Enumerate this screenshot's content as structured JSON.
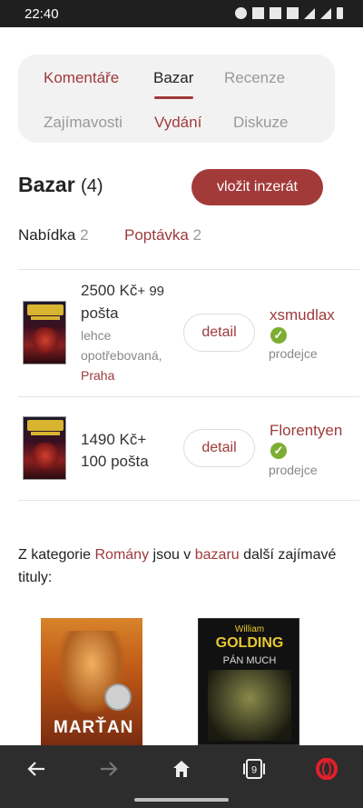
{
  "status_bar": {
    "time": "22:40"
  },
  "tabs": [
    {
      "label": "Komentáře",
      "state": "link"
    },
    {
      "label": "Bazar",
      "state": "active"
    },
    {
      "label": "Recenze",
      "state": "inactive"
    },
    {
      "label": "Zajímavosti",
      "state": "inactive"
    },
    {
      "label": "Vydání",
      "state": "link"
    },
    {
      "label": "Diskuze",
      "state": "inactive"
    }
  ],
  "bazar": {
    "title": "Bazar",
    "count": "(4)",
    "insert_button": "vložit inzerát",
    "filters": [
      {
        "label": "Nabídka",
        "count": "2"
      },
      {
        "label": "Poptávka",
        "count": "2"
      }
    ]
  },
  "listings": [
    {
      "price_line1": "2500 Kč",
      "price_extra": "+ 99",
      "price_line2": "pošta",
      "condition_line1": "lehce",
      "condition_line2": "opotřebovaná,",
      "city": "Praha",
      "detail_label": "detail",
      "seller": "xsmudlax",
      "seller_role": "prodejce"
    },
    {
      "price_line1": "1490 Kč+",
      "price_line2": "100 pošta",
      "detail_label": "detail",
      "seller": "Florentyen",
      "seller_role": "prodejce"
    }
  ],
  "recommendation": {
    "prefix": "Z kategorie ",
    "category": "Romány",
    "middle": " jsou v ",
    "bazar_link": "bazaru",
    "suffix": " další zajímavé tituly:"
  },
  "books": [
    {
      "cover_title": "MARŤAN"
    },
    {
      "author": "William",
      "cover_title": "GOLDING",
      "subtitle": "PÁN MUCH"
    }
  ],
  "colors": {
    "accent": "#9e3a3a",
    "verified": "#7cae32",
    "nav_bg": "#2d2d2d"
  },
  "bottom_nav": {
    "items": [
      "back-icon",
      "forward-icon",
      "home-icon",
      "tabs-icon",
      "opera-icon"
    ],
    "tab_count": "9"
  }
}
